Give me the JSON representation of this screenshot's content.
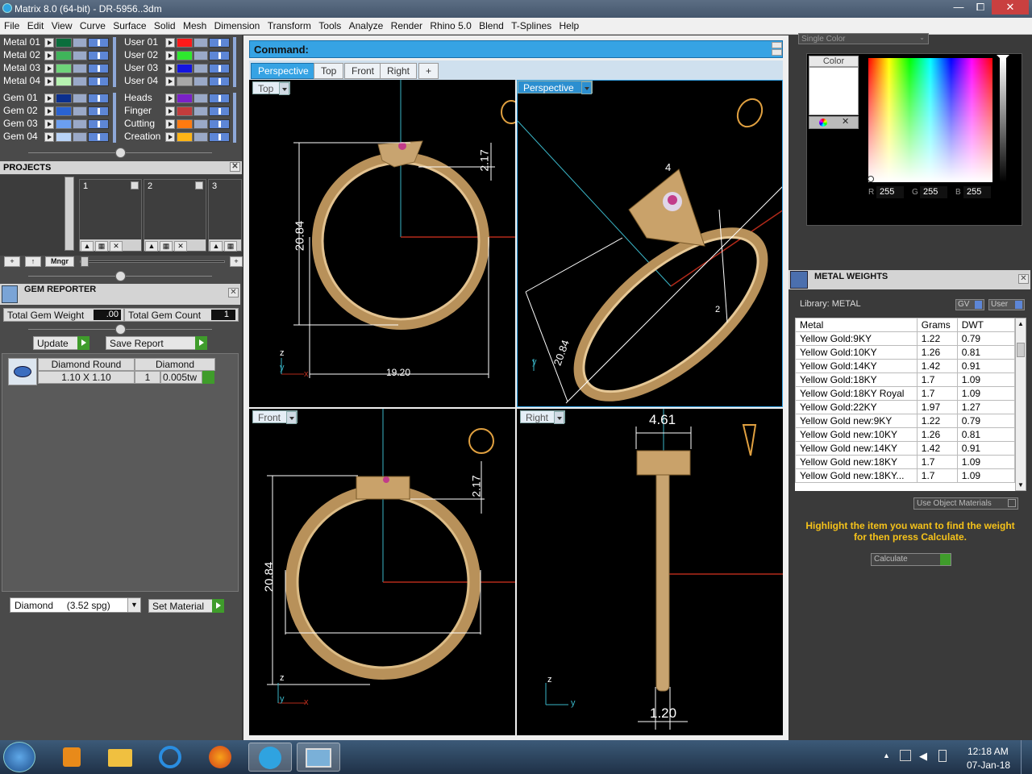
{
  "window": {
    "title": "Matrix 8.0 (64-bit) - DR-5956..3dm",
    "min": "—",
    "max": "⧠",
    "close": "✕"
  },
  "menu": [
    "File",
    "Edit",
    "View",
    "Curve",
    "Surface",
    "Solid",
    "Mesh",
    "Dimension",
    "Transform",
    "Tools",
    "Analyze",
    "Render",
    "Rhino 5.0",
    "Blend",
    "T-Splines",
    "Help"
  ],
  "layers": {
    "left": [
      {
        "name": "Metal 01",
        "color": "#0a6e3c"
      },
      {
        "name": "Metal 02",
        "color": "#3fb45a"
      },
      {
        "name": "Metal 03",
        "color": "#6ed47a"
      },
      {
        "name": "Metal 04",
        "color": "#b6f2b0"
      },
      {
        "name": "Gem 01",
        "color": "#0b2f8e"
      },
      {
        "name": "Gem 02",
        "color": "#2a63d2"
      },
      {
        "name": "Gem 03",
        "color": "#6b9ef0"
      },
      {
        "name": "Gem 04",
        "color": "#b9d3f7"
      }
    ],
    "right": [
      {
        "name": "User 01",
        "color": "#ff1a1a"
      },
      {
        "name": "User 02",
        "color": "#2ee82e"
      },
      {
        "name": "User 03",
        "color": "#1414e0"
      },
      {
        "name": "User 04",
        "color": "#a8a8a8"
      },
      {
        "name": "Heads",
        "color": "#7a21c8"
      },
      {
        "name": "Finger",
        "color": "#c23c3c"
      },
      {
        "name": "Cutting",
        "color": "#ff7a10"
      },
      {
        "name": "Creation",
        "color": "#ffb516"
      }
    ]
  },
  "projects": {
    "header": "PROJECTS",
    "slots": [
      "1",
      "2",
      "3"
    ],
    "mngr": "Mngr"
  },
  "gem_reporter": {
    "header": "GEM REPORTER",
    "total_weight_label": "Total Gem Weight",
    "total_weight_value": ".00",
    "total_count_label": "Total Gem Count",
    "total_count_value": "1",
    "update": "Update",
    "save_report": "Save Report",
    "col_shape": "Diamond Round",
    "col_material": "Diamond",
    "row": {
      "size": "1.10 X 1.10",
      "count": "1",
      "weight": "0.005tw"
    },
    "material_select": "Diamond     (3.52 spg)",
    "set_material": "Set Material"
  },
  "command": {
    "label": "Command:"
  },
  "view_tabs": [
    "Perspective",
    "Top",
    "Front",
    "Right",
    "+"
  ],
  "viewports": {
    "top": {
      "label": "Top",
      "dims": {
        "height": "20.84",
        "gap": "2.17",
        "width": "19.20"
      }
    },
    "perspective": {
      "label": "Perspective",
      "dims": {
        "d1": "20.84",
        "d2": "4",
        "d3": "2"
      }
    },
    "front": {
      "label": "Front",
      "dims": {
        "height": "20.84",
        "gap": "2.17"
      }
    },
    "right": {
      "label": "Right",
      "dims": {
        "top": "4.61",
        "bottom": "1.20"
      }
    }
  },
  "axes": {
    "z": "z",
    "y": "y",
    "x": "x"
  },
  "color_panel": {
    "mode": "Single Color",
    "label": "Color",
    "r_label": "R",
    "r": "255",
    "g_label": "G",
    "g": "255",
    "b_label": "B",
    "b": "255"
  },
  "metal_weights": {
    "header": "METAL WEIGHTS",
    "library": "Library: METAL",
    "gv": "GV",
    "user": "User",
    "columns": [
      "Metal",
      "Grams",
      "DWT"
    ],
    "rows": [
      [
        "Yellow Gold:9KY",
        "1.22",
        "0.79"
      ],
      [
        "Yellow Gold:10KY",
        "1.26",
        "0.81"
      ],
      [
        "Yellow Gold:14KY",
        "1.42",
        "0.91"
      ],
      [
        "Yellow Gold:18KY",
        "1.7",
        "1.09"
      ],
      [
        "Yellow Gold:18KY Royal",
        "1.7",
        "1.09"
      ],
      [
        "Yellow Gold:22KY",
        "1.97",
        "1.27"
      ],
      [
        "Yellow Gold new:9KY",
        "1.22",
        "0.79"
      ],
      [
        "Yellow Gold new:10KY",
        "1.26",
        "0.81"
      ],
      [
        "Yellow Gold new:14KY",
        "1.42",
        "0.91"
      ],
      [
        "Yellow Gold new:18KY",
        "1.7",
        "1.09"
      ],
      [
        "Yellow Gold new:18KY...",
        "1.7",
        "1.09"
      ]
    ],
    "use_object_materials": "Use Object Materials",
    "hint": "Highlight the item you want to find the weight for then press Calculate.",
    "calculate": "Calculate"
  },
  "tray": {
    "time": "12:18 AM",
    "date": "07-Jan-18"
  }
}
